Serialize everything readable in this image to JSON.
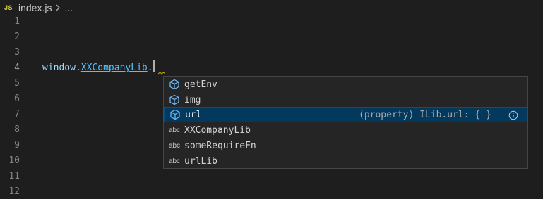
{
  "breadcrumb": {
    "file_icon": "JS",
    "file_name": "index.js",
    "separator_icon": "chevron-right-icon",
    "ellipsis": "..."
  },
  "gutter": {
    "line_numbers": [
      "1",
      "2",
      "3",
      "4",
      "5",
      "6",
      "7",
      "8",
      "9",
      "10",
      "11",
      "12"
    ],
    "active_line": "4"
  },
  "code": {
    "line4_object": "window",
    "line4_dot1": ".",
    "line4_member": "XXCompanyLib",
    "line4_dot2": "."
  },
  "suggestions": {
    "items": [
      {
        "label": "getEnv",
        "icon": "cube-icon"
      },
      {
        "label": "img",
        "icon": "cube-icon"
      },
      {
        "label": "url",
        "icon": "cube-icon",
        "detail": "(property) ILib.url: { }",
        "selected": true
      },
      {
        "label": "XXCompanyLib",
        "icon": "abc"
      },
      {
        "label": "someRequireFn",
        "icon": "abc"
      },
      {
        "label": "urlLib",
        "icon": "abc"
      }
    ]
  },
  "colors": {
    "background": "#1e1e1e",
    "selected_item": "#04395e",
    "cube_icon": "#75beff",
    "identifier": "#4fc1ff",
    "variable": "#9cdcfe"
  }
}
